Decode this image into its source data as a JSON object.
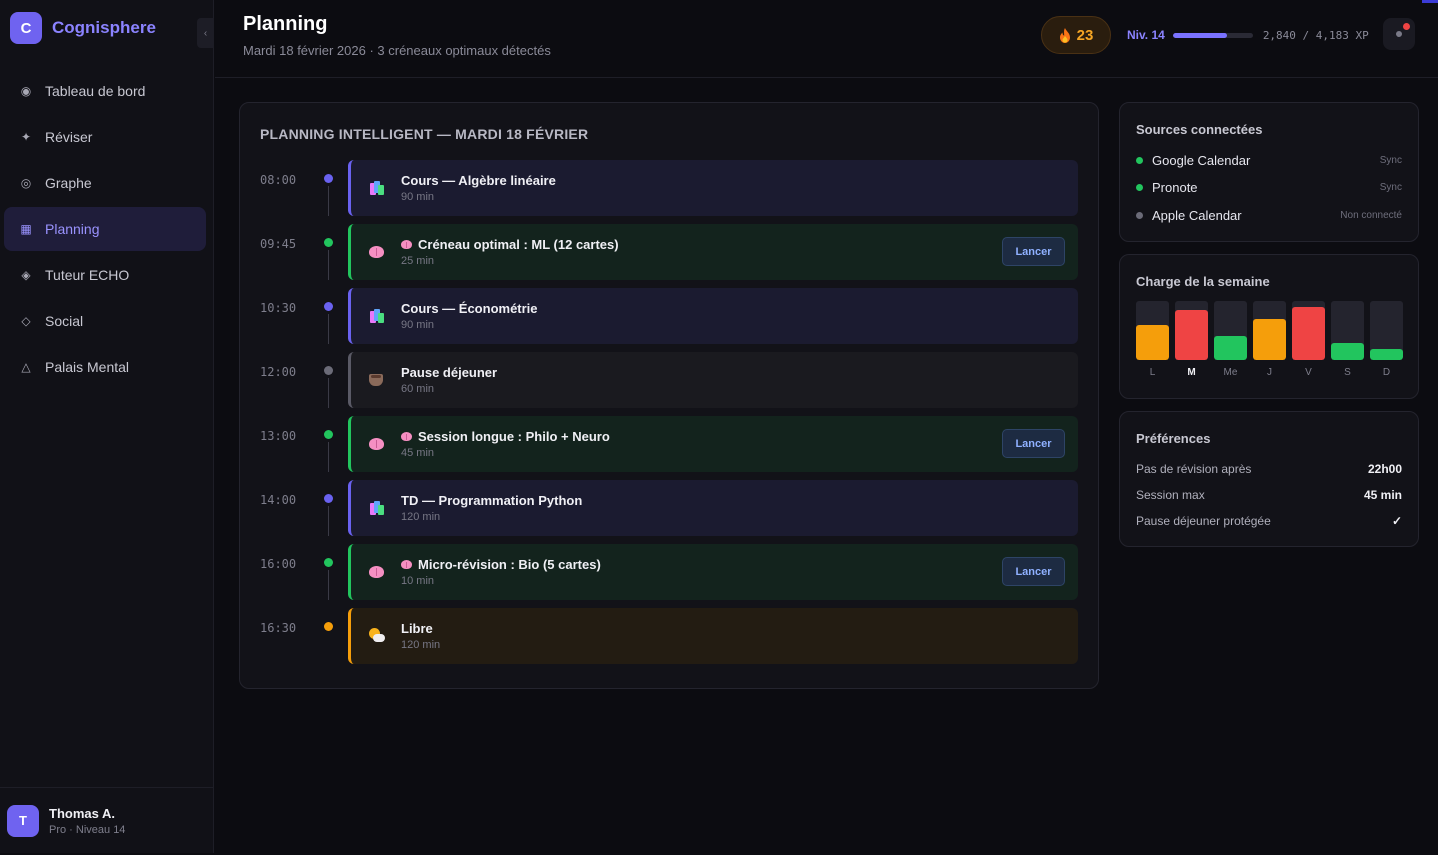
{
  "app": {
    "logo_letter": "C",
    "name": "Cognisphere",
    "collapse_glyph": "‹"
  },
  "sidebar": {
    "items": [
      {
        "label": "Tableau de bord",
        "icon": "◉",
        "icon_name": "dashboard-icon"
      },
      {
        "label": "Réviser",
        "icon": "✦",
        "icon_name": "sparkle-icon"
      },
      {
        "label": "Graphe",
        "icon": "◎",
        "icon_name": "graph-icon"
      },
      {
        "label": "Planning",
        "icon": "▦",
        "icon_name": "calendar-icon",
        "active": true
      },
      {
        "label": "Tuteur ECHO",
        "icon": "◈",
        "icon_name": "tutor-icon"
      },
      {
        "label": "Social",
        "icon": "◇",
        "icon_name": "social-icon"
      },
      {
        "label": "Palais Mental",
        "icon": "△",
        "icon_name": "palace-icon"
      }
    ]
  },
  "user": {
    "initial": "T",
    "name": "Thomas A.",
    "subtitle": "Pro · Niveau 14"
  },
  "header": {
    "title": "Planning",
    "subtitle": "Mardi 18 février 2026 · 3 créneaux optimaux détectés",
    "streak": "23",
    "level_label": "Niv. 14",
    "xp_text": "2,840 / 4,183 XP",
    "xp_progress": 0.679
  },
  "planning": {
    "title": "PLANNING INTELLIGENT — MARDI 18 FÉVRIER",
    "launch_label": "Lancer",
    "events": [
      {
        "time": "08:00",
        "type": "course",
        "title": "Cours — Algèbre linéaire",
        "duration": "90 min"
      },
      {
        "time": "09:45",
        "type": "opt",
        "title": "Créneau optimal : ML (12 cartes)",
        "duration": "25 min"
      },
      {
        "time": "10:30",
        "type": "course",
        "title": "Cours — Économétrie",
        "duration": "90 min"
      },
      {
        "time": "12:00",
        "type": "pause",
        "title": "Pause déjeuner",
        "duration": "60 min"
      },
      {
        "time": "13:00",
        "type": "opt",
        "title": "Session longue : Philo + Neuro",
        "duration": "45 min"
      },
      {
        "time": "14:00",
        "type": "course",
        "title": "TD — Programmation Python",
        "duration": "120 min"
      },
      {
        "time": "16:00",
        "type": "opt",
        "title": "Micro-révision : Bio (5 cartes)",
        "duration": "10 min"
      },
      {
        "time": "16:30",
        "type": "free",
        "title": "Libre",
        "duration": "120 min"
      }
    ]
  },
  "sources": {
    "title": "Sources connectées",
    "items": [
      {
        "name": "Google Calendar",
        "status": "Sync",
        "color": "#22c55e"
      },
      {
        "name": "Pronote",
        "status": "Sync",
        "color": "#22c55e"
      },
      {
        "name": "Apple Calendar",
        "status": "Non connecté",
        "color": "#6b6b78"
      }
    ]
  },
  "weekload": {
    "title": "Charge de la semaine",
    "current_day": "M",
    "days": [
      {
        "label": "L",
        "level": 0.6,
        "color": "#f59e0b"
      },
      {
        "label": "M",
        "level": 0.85,
        "color": "#ef4444"
      },
      {
        "label": "Me",
        "level": 0.4,
        "color": "#22c55e"
      },
      {
        "label": "J",
        "level": 0.7,
        "color": "#f59e0b"
      },
      {
        "label": "V",
        "level": 0.9,
        "color": "#ef4444"
      },
      {
        "label": "S",
        "level": 0.28,
        "color": "#22c55e"
      },
      {
        "label": "D",
        "level": 0.18,
        "color": "#22c55e"
      }
    ]
  },
  "preferences": {
    "title": "Préférences",
    "items": [
      {
        "label": "Pas de révision après",
        "value": "22h00"
      },
      {
        "label": "Session max",
        "value": "45 min"
      },
      {
        "label": "Pause déjeuner protégée",
        "value": "✓"
      }
    ]
  }
}
